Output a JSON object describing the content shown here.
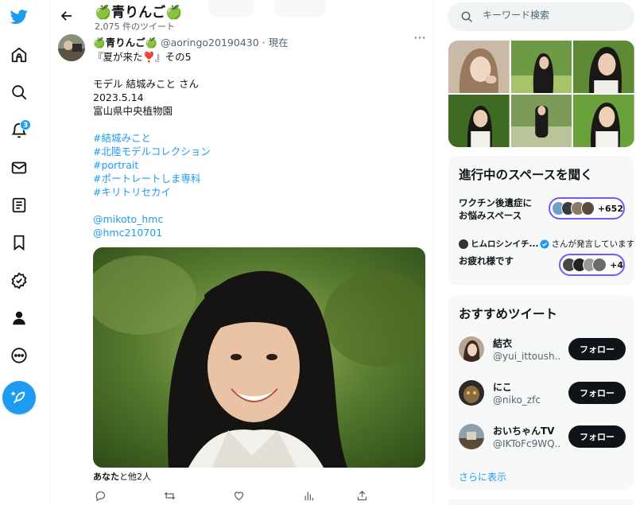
{
  "colors": {
    "accent": "#1d9bf0",
    "text": "#0f1419",
    "secondary": "#536471",
    "spaces_ring": "#7856ff",
    "panel_bg": "#f7f9f9"
  },
  "nav": {
    "items": [
      {
        "name": "twitter-logo",
        "icon": "bird-icon"
      },
      {
        "name": "home",
        "icon": "home-icon"
      },
      {
        "name": "explore",
        "icon": "search-icon"
      },
      {
        "name": "notifications",
        "icon": "bell-icon",
        "badge": "3"
      },
      {
        "name": "messages",
        "icon": "mail-icon"
      },
      {
        "name": "lists",
        "icon": "list-icon"
      },
      {
        "name": "bookmarks",
        "icon": "bookmark-icon"
      },
      {
        "name": "verified",
        "icon": "verified-icon"
      },
      {
        "name": "profile",
        "icon": "person-icon"
      },
      {
        "name": "more",
        "icon": "more-circle-icon"
      }
    ],
    "notifications_badge": "3"
  },
  "header": {
    "title": "🍏青りんご🍏",
    "subtitle": "2,075 件のツイート"
  },
  "tweet": {
    "name": "🍏青りんご🍏",
    "handle": "@aoringo20190430",
    "separator": " · ",
    "time": "現在",
    "lines": [
      {
        "text": "『夏が来た❣️』その5",
        "link": false
      },
      {
        "text": "",
        "link": false
      },
      {
        "text": "モデル 結城みこと さん",
        "link": false
      },
      {
        "text": "2023.5.14",
        "link": false
      },
      {
        "text": "富山県中央植物園",
        "link": false
      },
      {
        "text": "",
        "link": false
      },
      {
        "text": "#結城みこと",
        "link": true
      },
      {
        "text": "#北陸モデルコレクション",
        "link": true
      },
      {
        "text": "#portrait",
        "link": true
      },
      {
        "text": "#ポートレートしま専科",
        "link": true
      },
      {
        "text": "#キリトリセカイ",
        "link": true
      },
      {
        "text": "",
        "link": false
      },
      {
        "text": "@mikoto_hmc",
        "link": true
      },
      {
        "text": "@hmc210701",
        "link": true
      }
    ],
    "likes_bold": "あなた",
    "likes_rest": "と他2人"
  },
  "search": {
    "placeholder": "キーワード検索"
  },
  "spaces": {
    "title": "進行中のスペースを聞く",
    "items": [
      {
        "title_line1": "ワクチン後遺症に",
        "title_line2": "お悩みスペース",
        "count": "+652"
      },
      {
        "speaker": "ヒムロシンイチ...",
        "speaker_suffix": "さんが発言しています",
        "title": "お疲れ様です",
        "count": "+4"
      }
    ]
  },
  "recommendations": {
    "title": "おすすめツイート",
    "follow_label": "フォロー",
    "show_more": "さらに表示",
    "users": [
      {
        "name": "結衣",
        "handle": "@yui_ittoush..."
      },
      {
        "name": "にこ",
        "handle": "@niko_zfc"
      },
      {
        "name": "おいちゃんTV",
        "handle": "@IKToFc9WQ..."
      }
    ]
  }
}
